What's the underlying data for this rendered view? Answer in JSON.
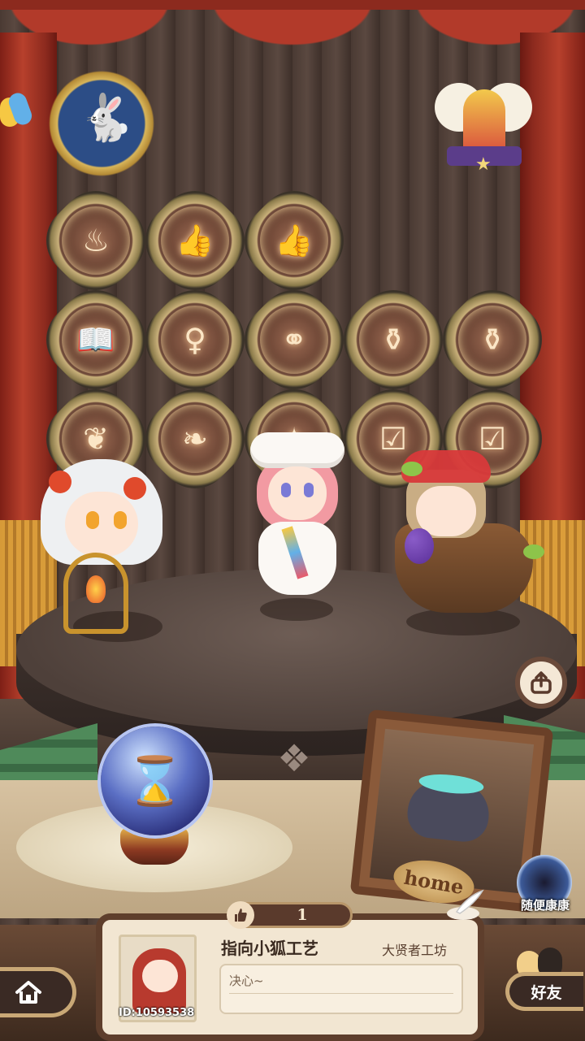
{
  "stage": {
    "badges_row1": [
      "pot-icon",
      "thumbs-up-icon",
      "thumbs-up-laurel-icon"
    ],
    "badges_row2": [
      "book-icon",
      "fairy-icon",
      "twin-fairies-icon",
      "cauldron-icon",
      "cauldron-icon"
    ],
    "badges_row3": [
      "swirl-icon",
      "leaf-icon",
      "sparkle-icon",
      "checklist-icon",
      "checklist-icon"
    ]
  },
  "home_sign": {
    "label": "home"
  },
  "random_visit": {
    "label": "随便康康"
  },
  "profile": {
    "likes": "1",
    "name": "指向小狐工艺",
    "workshop": "大贤者工坊",
    "motto": "决心~",
    "id_label": "ID:10593538"
  },
  "friends": {
    "label": "好友"
  },
  "colors": {
    "curtain": "#b23a2a",
    "gold": "#c9a876",
    "card": "#f2e6d2"
  }
}
